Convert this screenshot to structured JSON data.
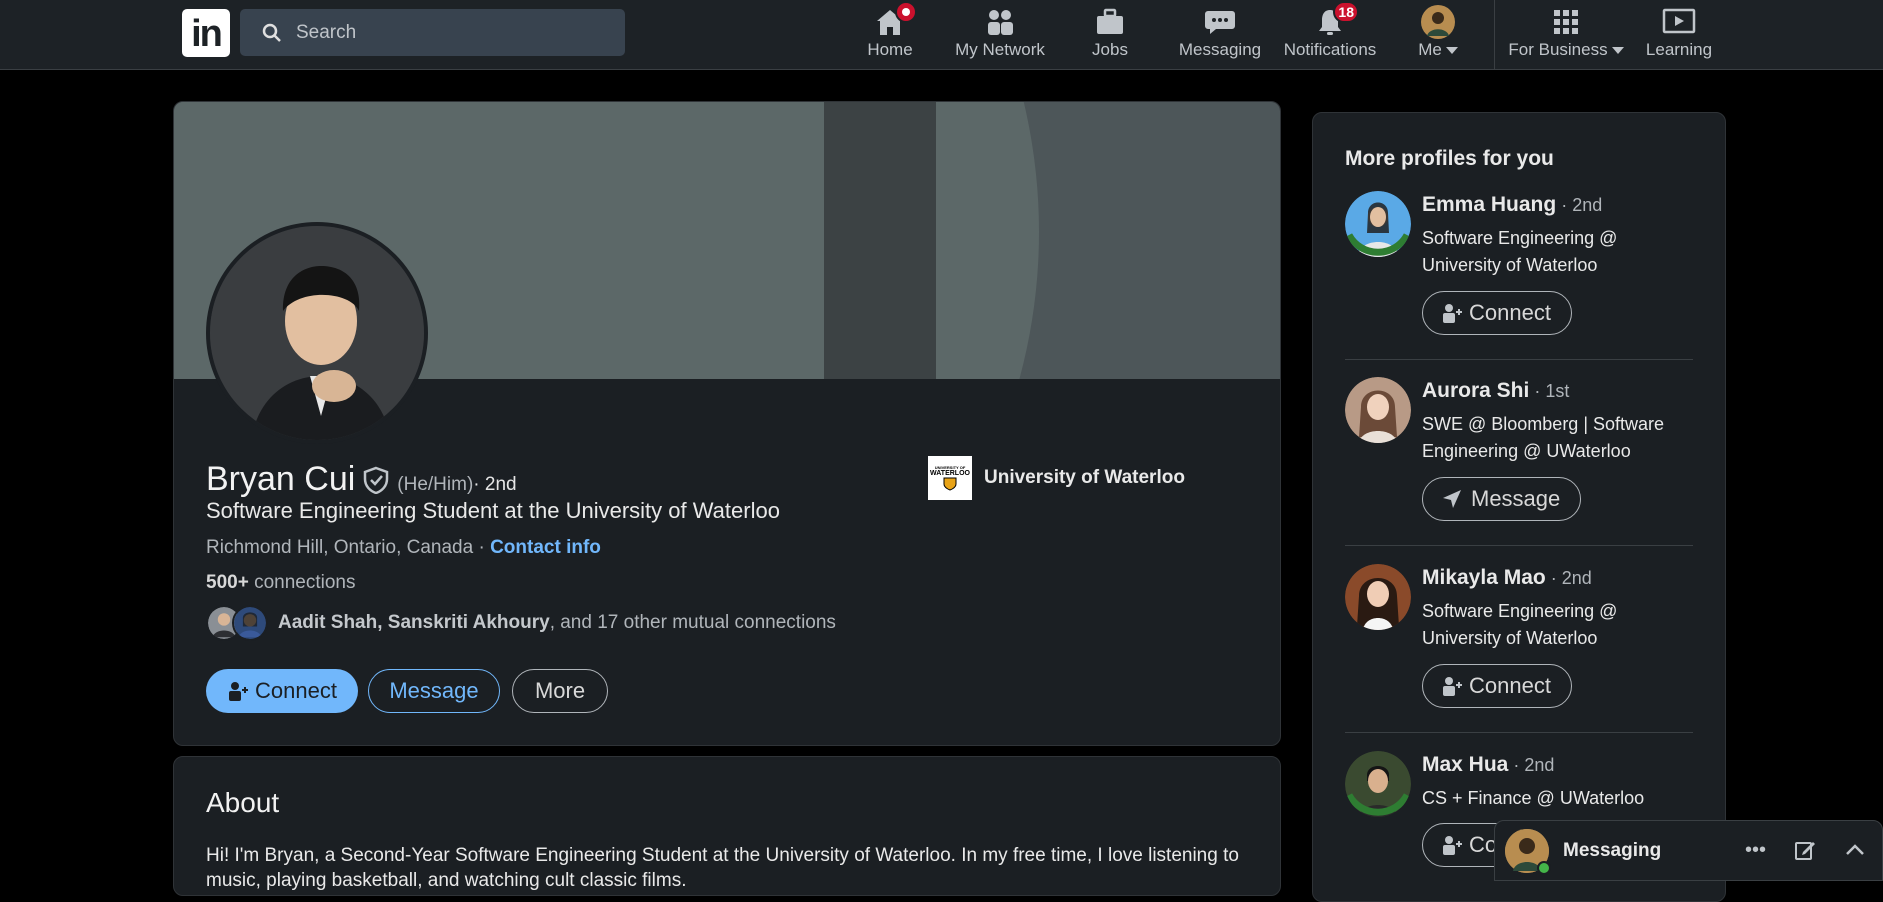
{
  "topbar": {
    "logo_text": "in",
    "search_placeholder": "Search",
    "nav": [
      {
        "label": "Home",
        "icon": "home-icon",
        "badge": ""
      },
      {
        "label": "My Network",
        "icon": "network-icon",
        "badge": ""
      },
      {
        "label": "Jobs",
        "icon": "briefcase-icon",
        "badge": ""
      },
      {
        "label": "Messaging",
        "icon": "messaging-icon",
        "badge": ""
      },
      {
        "label": "Notifications",
        "icon": "bell-icon",
        "badge": "18"
      },
      {
        "label": "Me",
        "icon": "avatar-icon",
        "badge": ""
      },
      {
        "label": "For Business",
        "icon": "grid-icon",
        "badge": ""
      },
      {
        "label": "Learning",
        "icon": "learning-icon",
        "badge": ""
      }
    ]
  },
  "profile": {
    "name": "Bryan Cui",
    "pronouns": "(He/Him)",
    "degree": " · 2nd",
    "headline": "Software Engineering Student at the University of Waterloo",
    "location": "Richmond Hill, Ontario, Canada · ",
    "contact_info": "Contact info",
    "connections_count": "500+",
    "connections_label": " connections",
    "mutual_names": "Aadit Shah, Sanskriti Akhoury",
    "mutual_rest": ", and 17 other mutual connections",
    "school": "University of Waterloo",
    "school_logo_text": "UNIVERSITY OF",
    "school_logo_word": "WATERLOO",
    "buttons": {
      "connect": "Connect",
      "message": "Message",
      "more": "More"
    }
  },
  "about": {
    "title": "About",
    "text": "Hi! I'm Bryan, a Second-Year Software Engineering Student at the University of Waterloo. In my free time, I love listening to music, playing basketball, and watching cult classic films."
  },
  "sidebar": {
    "title": "More profiles for you",
    "people": [
      {
        "name": "Emma Huang",
        "degree": " · 2nd",
        "desc": "Software Engineering @ University of Waterloo",
        "action": "Connect"
      },
      {
        "name": "Aurora Shi",
        "degree": " · 1st",
        "desc": "SWE @ Bloomberg | Software Engineering @ UWaterloo",
        "action": "Message"
      },
      {
        "name": "Mikayla Mao",
        "degree": " · 2nd",
        "desc": "Software Engineering @ University of Waterloo",
        "action": "Connect"
      },
      {
        "name": "Max Hua",
        "degree": " · 2nd",
        "desc": "CS + Finance @ UWaterloo",
        "action": "Co"
      }
    ]
  },
  "messaging": {
    "title": "Messaging"
  },
  "colors": {
    "accent": "#71b7fb",
    "badge": "#cb112d",
    "background": "#000000",
    "card": "#1b1f23"
  }
}
